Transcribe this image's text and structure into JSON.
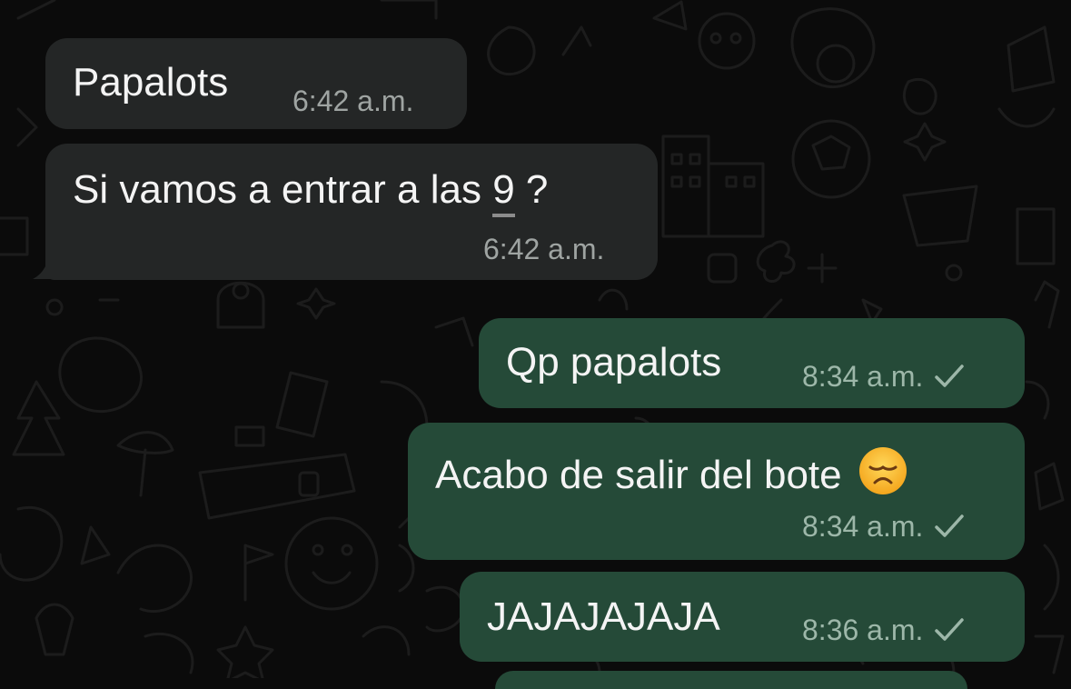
{
  "messages": [
    {
      "text": "Papalots",
      "time": "6:42 a.m.",
      "direction": "incoming"
    },
    {
      "text_before": "Si vamos a entrar a las ",
      "underlined": "9",
      "text_after": " ?",
      "time": "6:42 a.m.",
      "direction": "incoming"
    },
    {
      "text": "Qp papalots",
      "time": "8:34 a.m.",
      "direction": "outgoing",
      "status": "sent-check-icon"
    },
    {
      "text": "Acabo de salir del bote",
      "emoji": "disappointed-face-emoji",
      "time": "8:34 a.m.",
      "direction": "outgoing",
      "status": "sent-check-icon"
    },
    {
      "text": "JAJAJAJAJA",
      "time": "8:36 a.m.",
      "direction": "outgoing",
      "status": "sent-check-icon"
    }
  ],
  "colors": {
    "background": "#0b0b0b",
    "incoming_bubble": "#242626",
    "outgoing_bubble": "#254a38",
    "text": "#f4f4f4",
    "meta_incoming": "#9fa4a2",
    "meta_outgoing": "#9db7a9"
  }
}
